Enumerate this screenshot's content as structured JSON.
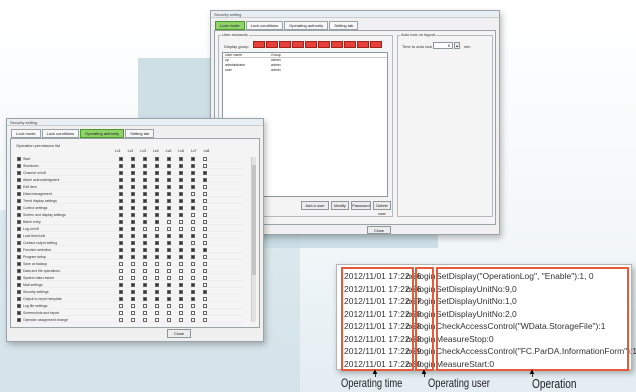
{
  "upper_window": {
    "title": "Security setting",
    "tabs": [
      "Lock mode",
      "Lock conditions",
      "Operating authority",
      "Setting tab"
    ],
    "list_group_label": "User accounts",
    "group_label_row": "Display group",
    "columns": [
      "User name",
      "Group"
    ],
    "rows": [
      {
        "name": "op",
        "group": "admin"
      },
      {
        "name": "administrator",
        "group": "admin"
      },
      {
        "name": "user",
        "group": "admin"
      }
    ],
    "right_group_label": "Auto lock on logout",
    "right_field_label": "Time to auto lock",
    "right_field_value": "5",
    "right_field_unit": "min",
    "bottom_buttons": [
      "Add a user",
      "Modify",
      "Password",
      "Delete user"
    ],
    "close_button": "Close"
  },
  "lower_window": {
    "title": "Security setting",
    "tabs": [
      "Lock mode",
      "Lock conditions",
      "Operating authority",
      "Setting tab"
    ],
    "group_label": "Operation permission list",
    "col_headers": [
      "Lv1",
      "Lv2",
      "Lv3",
      "Lv4",
      "Lv5",
      "Lv6",
      "Lv7",
      "Lv8"
    ],
    "rows": [
      {
        "label": "Start",
        "checks": [
          1,
          1,
          1,
          1,
          1,
          1,
          1,
          0
        ]
      },
      {
        "label": "Shutdown",
        "checks": [
          1,
          1,
          1,
          1,
          1,
          1,
          1,
          0
        ]
      },
      {
        "label": "Channel on/off",
        "checks": [
          1,
          1,
          1,
          1,
          1,
          1,
          1,
          1
        ]
      },
      {
        "label": "Alarm acknowledgment",
        "checks": [
          1,
          1,
          1,
          1,
          1,
          1,
          1,
          1
        ]
      },
      {
        "label": "Edit item",
        "checks": [
          1,
          1,
          1,
          1,
          1,
          1,
          1,
          0
        ]
      },
      {
        "label": "Data management",
        "checks": [
          1,
          1,
          1,
          1,
          1,
          1,
          0,
          0
        ]
      },
      {
        "label": "Trend display settings",
        "checks": [
          1,
          1,
          1,
          1,
          1,
          1,
          1,
          0
        ]
      },
      {
        "label": "Control settings",
        "checks": [
          1,
          1,
          1,
          1,
          1,
          1,
          1,
          0
        ]
      },
      {
        "label": "Screen and display settings",
        "checks": [
          1,
          1,
          1,
          1,
          1,
          1,
          0,
          0
        ]
      },
      {
        "label": "Batch entry",
        "checks": [
          1,
          1,
          1,
          1,
          0,
          0,
          0,
          0
        ]
      },
      {
        "label": "Log-on/off",
        "checks": [
          1,
          1,
          0,
          0,
          0,
          0,
          0,
          0
        ]
      },
      {
        "label": "Lock time/Unit",
        "checks": [
          1,
          1,
          1,
          1,
          1,
          1,
          1,
          0
        ]
      },
      {
        "label": "Contact output setting",
        "checks": [
          1,
          1,
          1,
          1,
          1,
          1,
          0,
          0
        ]
      },
      {
        "label": "Function selection",
        "checks": [
          1,
          1,
          1,
          1,
          1,
          1,
          1,
          1
        ]
      },
      {
        "label": "Program setup",
        "checks": [
          1,
          1,
          1,
          1,
          1,
          1,
          1,
          0
        ]
      },
      {
        "label": "Save at backup",
        "checks": [
          0,
          0,
          0,
          0,
          0,
          0,
          0,
          0
        ]
      },
      {
        "label": "Data and file operations",
        "checks": [
          0,
          0,
          0,
          0,
          0,
          0,
          0,
          0
        ]
      },
      {
        "label": "System data restore",
        "checks": [
          0,
          0,
          0,
          0,
          0,
          0,
          0,
          0
        ]
      },
      {
        "label": "Mail settings",
        "checks": [
          1,
          1,
          1,
          1,
          1,
          1,
          1,
          0
        ]
      },
      {
        "label": "Security settings",
        "checks": [
          1,
          1,
          1,
          1,
          1,
          1,
          1,
          1
        ]
      },
      {
        "label": "Output to report template",
        "checks": [
          1,
          1,
          1,
          1,
          1,
          1,
          1,
          0
        ]
      },
      {
        "label": "Log file settings",
        "checks": [
          0,
          0,
          0,
          0,
          0,
          0,
          0,
          0
        ]
      },
      {
        "label": "Screenshots and report",
        "checks": [
          0,
          0,
          0,
          0,
          0,
          0,
          0,
          0
        ]
      },
      {
        "label": "Operator assignment change",
        "checks": [
          0,
          0,
          0,
          0,
          0,
          0,
          0,
          0
        ]
      }
    ],
    "close_button": "Close"
  },
  "log_panel": {
    "lines": [
      {
        "time": "2012/11/01 17:22:26",
        "user": "oc:login",
        "op": "SetDisplay(\"OperationLog\", \"Enable\"):1, 0"
      },
      {
        "time": "2012/11/01 17:22:26",
        "user": "oc:login",
        "op": "SetDisplayUnitNo:9,0"
      },
      {
        "time": "2012/11/01 17:22:27",
        "user": "oc:login",
        "op": "SetDisplayUnitNo:1,0"
      },
      {
        "time": "2012/11/01 17:22:28",
        "user": "oc:login",
        "op": "SetDisplayUnitNo:2,0"
      },
      {
        "time": "2012/11/01 17:22:28",
        "user": "oc:login",
        "op": "CheckAccessControl(\"WData.StorageFile\"):1"
      },
      {
        "time": "2012/11/01 17:22:28",
        "user": "oc:login",
        "op": "MeasureStop:0"
      },
      {
        "time": "2012/11/01 17:22:29",
        "user": "oc:login",
        "op": "CheckAccessControl(\"FC.ParDA.InformationForm\"):1"
      },
      {
        "time": "2012/11/01 17:22:30",
        "user": "oc:login",
        "op": "MeasureStart:0"
      }
    ]
  },
  "captions": {
    "time": "Operating time",
    "user": "Operating user",
    "operation": "Operation"
  },
  "colors": {
    "active_tab": "#8fd36a",
    "highlight_red": "#e65a3a",
    "background_band": "#c9dce3"
  }
}
